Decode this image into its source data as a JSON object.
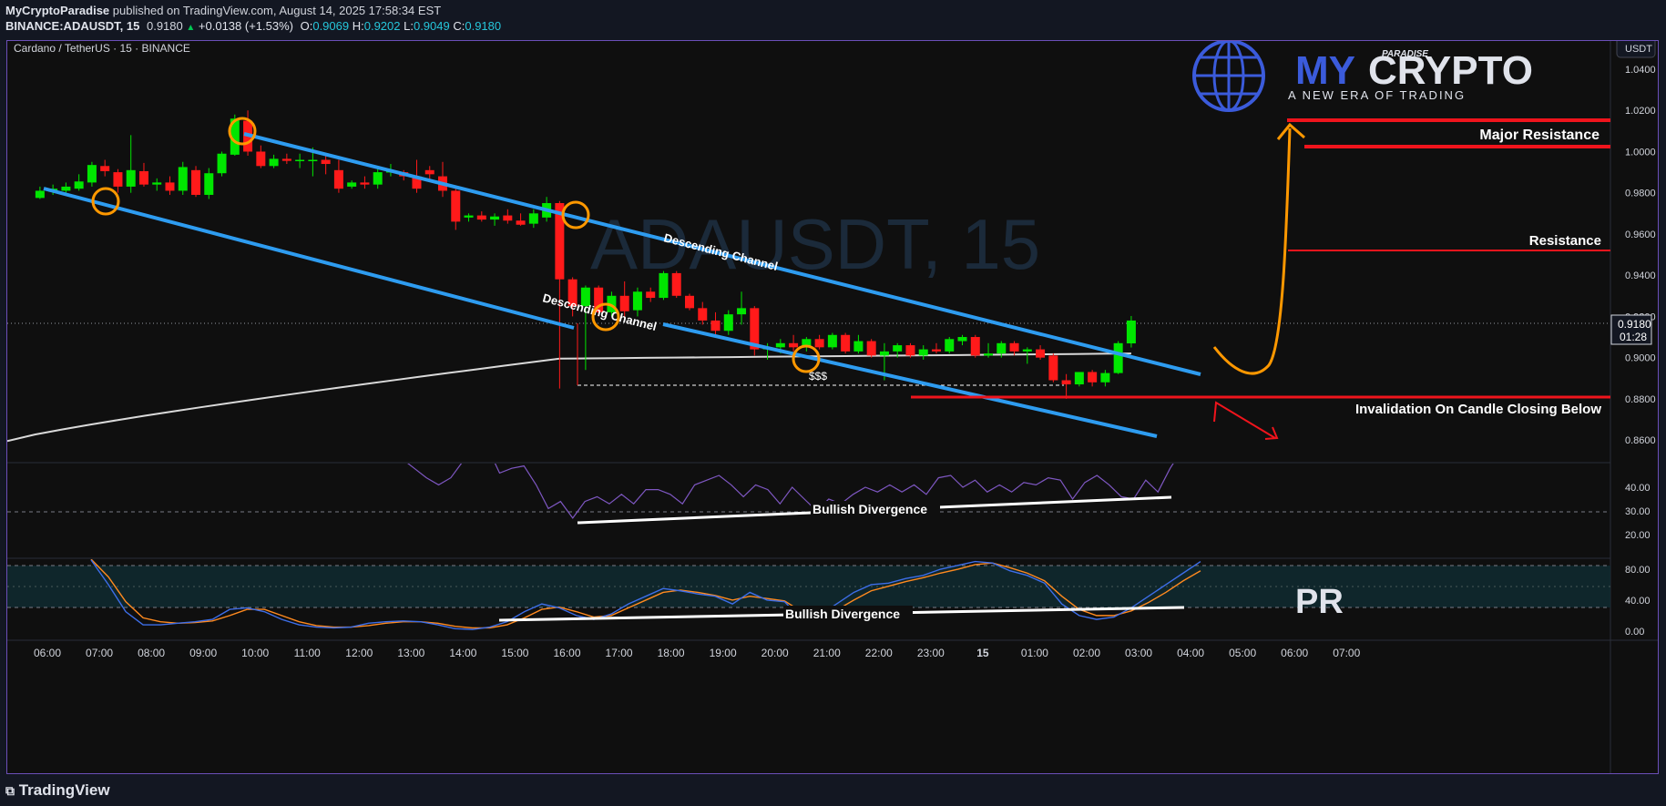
{
  "header": {
    "publisher": "MyCryptoParadise",
    "published_text": "published on TradingView.com, August 14, 2025 17:58:34 EST",
    "symbol_line": "BINANCE:ADAUSDT, 15",
    "last": "0.9180",
    "change": "+0.0138 (+1.53%)",
    "o_label": "O:",
    "o": "0.9069",
    "h_label": "H:",
    "h": "0.9202",
    "l_label": "L:",
    "l": "0.9049",
    "c_label": "C:",
    "c": "0.9180"
  },
  "chart_title": "Cardano / TetherUS · 15 · BINANCE",
  "watermark": "ADAUSDT, 15",
  "currency_button": "USDT",
  "brand": {
    "paradise": "PARADISE",
    "my": "MY",
    "crypto": "CRYPTO",
    "tagline": "A NEW ERA OF TRADING",
    "pr": "PR"
  },
  "footer": {
    "logo": "TradingView"
  },
  "price_tag": {
    "price": "0.9180",
    "countdown": "01:28"
  },
  "annotations": {
    "major_resistance": "Major Resistance",
    "resistance": "Resistance",
    "invalidation": "Invalidation On Candle Closing Below",
    "channel_upper": "Descending Channel",
    "channel_lower": "Descending Channel",
    "liquidity": "$$$",
    "rsi_divergence": "Bullish Divergence",
    "stoch_divergence": "Bullish Divergence"
  },
  "colors": {
    "up": "#00e600",
    "down": "#ff1a1a",
    "channel": "#2e9cf0",
    "resistance": "#f0141c",
    "projection": "#ff9800",
    "rsi": "#7e57c2",
    "stoch_k": "#3d6ee8",
    "stoch_d": "#ff8a1f",
    "accent_frame": "#6b4fb8"
  },
  "chart_data": [
    {
      "type": "candlestick",
      "title": "Cardano / TetherUS · 15 · BINANCE",
      "y_unit": "USDT",
      "ylim": [
        0.849,
        1.0537
      ],
      "x_ticks": [
        "06:00",
        "07:00",
        "08:00",
        "09:00",
        "10:00",
        "11:00",
        "12:00",
        "13:00",
        "14:00",
        "15:00",
        "16:00",
        "17:00",
        "18:00",
        "19:00",
        "20:00",
        "21:00",
        "22:00",
        "23:00",
        "15",
        "01:00",
        "02:00",
        "03:00",
        "04:00",
        "05:00",
        "06:00",
        "07:00"
      ],
      "y_ticks": [
        "1.0400",
        "1.0200",
        "1.0000",
        "0.9800",
        "0.9600",
        "0.9400",
        "0.9200",
        "0.9000",
        "0.8800",
        "0.8600"
      ],
      "candle_interval_minutes": 15,
      "first_candle_time": "05:45",
      "candles": [
        {
          "o": 0.9775,
          "h": 0.983,
          "l": 0.977,
          "c": 0.981
        },
        {
          "o": 0.9805,
          "h": 0.984,
          "l": 0.979,
          "c": 0.982
        },
        {
          "o": 0.981,
          "h": 0.985,
          "l": 0.98,
          "c": 0.983
        },
        {
          "o": 0.982,
          "h": 0.989,
          "l": 0.981,
          "c": 0.9855
        },
        {
          "o": 0.985,
          "h": 0.995,
          "l": 0.983,
          "c": 0.9935
        },
        {
          "o": 0.993,
          "h": 0.996,
          "l": 0.988,
          "c": 0.9905
        },
        {
          "o": 0.99,
          "h": 0.9915,
          "l": 0.98,
          "c": 0.983
        },
        {
          "o": 0.983,
          "h": 1.008,
          "l": 0.98,
          "c": 0.991
        },
        {
          "o": 0.9905,
          "h": 0.9945,
          "l": 0.983,
          "c": 0.984
        },
        {
          "o": 0.984,
          "h": 0.987,
          "l": 0.981,
          "c": 0.985
        },
        {
          "o": 0.985,
          "h": 0.988,
          "l": 0.979,
          "c": 0.981
        },
        {
          "o": 0.981,
          "h": 0.995,
          "l": 0.979,
          "c": 0.9925
        },
        {
          "o": 0.991,
          "h": 0.993,
          "l": 0.978,
          "c": 0.979
        },
        {
          "o": 0.979,
          "h": 0.992,
          "l": 0.977,
          "c": 0.9895
        },
        {
          "o": 0.9895,
          "h": 1.0,
          "l": 0.988,
          "c": 0.999
        },
        {
          "o": 0.9985,
          "h": 1.018,
          "l": 0.998,
          "c": 1.016
        },
        {
          "o": 1.015,
          "h": 1.02,
          "l": 0.998,
          "c": 1.0
        },
        {
          "o": 1.0,
          "h": 1.003,
          "l": 0.992,
          "c": 0.993
        },
        {
          "o": 0.993,
          "h": 0.9985,
          "l": 0.992,
          "c": 0.9965
        },
        {
          "o": 0.9965,
          "h": 0.999,
          "l": 0.994,
          "c": 0.9955
        },
        {
          "o": 0.9955,
          "h": 0.999,
          "l": 0.992,
          "c": 0.996
        },
        {
          "o": 0.996,
          "h": 1.002,
          "l": 0.988,
          "c": 0.996
        },
        {
          "o": 0.996,
          "h": 0.999,
          "l": 0.989,
          "c": 0.994
        },
        {
          "o": 0.991,
          "h": 0.996,
          "l": 0.98,
          "c": 0.982
        },
        {
          "o": 0.983,
          "h": 0.986,
          "l": 0.982,
          "c": 0.985
        },
        {
          "o": 0.985,
          "h": 0.988,
          "l": 0.982,
          "c": 0.984
        },
        {
          "o": 0.984,
          "h": 0.992,
          "l": 0.982,
          "c": 0.99
        },
        {
          "o": 0.99,
          "h": 0.994,
          "l": 0.988,
          "c": 0.9905
        },
        {
          "o": 0.99,
          "h": 0.991,
          "l": 0.986,
          "c": 0.988
        },
        {
          "o": 0.988,
          "h": 0.996,
          "l": 0.98,
          "c": 0.982
        },
        {
          "o": 0.991,
          "h": 0.993,
          "l": 0.986,
          "c": 0.989
        },
        {
          "o": 0.988,
          "h": 0.995,
          "l": 0.978,
          "c": 0.981
        },
        {
          "o": 0.981,
          "h": 0.982,
          "l": 0.962,
          "c": 0.966
        },
        {
          "o": 0.968,
          "h": 0.97,
          "l": 0.966,
          "c": 0.969
        },
        {
          "o": 0.969,
          "h": 0.971,
          "l": 0.966,
          "c": 0.967
        },
        {
          "o": 0.967,
          "h": 0.97,
          "l": 0.964,
          "c": 0.9685
        },
        {
          "o": 0.969,
          "h": 0.972,
          "l": 0.965,
          "c": 0.9665
        },
        {
          "o": 0.9665,
          "h": 0.97,
          "l": 0.964,
          "c": 0.9645
        },
        {
          "o": 0.965,
          "h": 0.972,
          "l": 0.963,
          "c": 0.97
        },
        {
          "o": 0.968,
          "h": 0.978,
          "l": 0.966,
          "c": 0.975
        },
        {
          "o": 0.975,
          "h": 0.976,
          "l": 0.885,
          "c": 0.938
        },
        {
          "o": 0.938,
          "h": 0.939,
          "l": 0.92,
          "c": 0.925
        },
        {
          "o": 0.925,
          "h": 0.935,
          "l": 0.894,
          "c": 0.934
        },
        {
          "o": 0.934,
          "h": 0.935,
          "l": 0.92,
          "c": 0.922
        },
        {
          "o": 0.922,
          "h": 0.932,
          "l": 0.92,
          "c": 0.93
        },
        {
          "o": 0.93,
          "h": 0.937,
          "l": 0.918,
          "c": 0.9225
        },
        {
          "o": 0.923,
          "h": 0.934,
          "l": 0.92,
          "c": 0.932
        },
        {
          "o": 0.932,
          "h": 0.934,
          "l": 0.927,
          "c": 0.929
        },
        {
          "o": 0.929,
          "h": 0.942,
          "l": 0.928,
          "c": 0.941
        },
        {
          "o": 0.941,
          "h": 0.942,
          "l": 0.929,
          "c": 0.93
        },
        {
          "o": 0.93,
          "h": 0.931,
          "l": 0.923,
          "c": 0.924
        },
        {
          "o": 0.924,
          "h": 0.927,
          "l": 0.916,
          "c": 0.918
        },
        {
          "o": 0.918,
          "h": 0.922,
          "l": 0.91,
          "c": 0.913
        },
        {
          "o": 0.913,
          "h": 0.923,
          "l": 0.911,
          "c": 0.921
        },
        {
          "o": 0.921,
          "h": 0.932,
          "l": 0.916,
          "c": 0.924
        },
        {
          "o": 0.924,
          "h": 0.925,
          "l": 0.901,
          "c": 0.904
        },
        {
          "o": 0.904,
          "h": 0.907,
          "l": 0.899,
          "c": 0.905
        },
        {
          "o": 0.905,
          "h": 0.909,
          "l": 0.902,
          "c": 0.907
        },
        {
          "o": 0.907,
          "h": 0.911,
          "l": 0.903,
          "c": 0.905
        },
        {
          "o": 0.905,
          "h": 0.91,
          "l": 0.903,
          "c": 0.909
        },
        {
          "o": 0.909,
          "h": 0.911,
          "l": 0.904,
          "c": 0.905
        },
        {
          "o": 0.905,
          "h": 0.912,
          "l": 0.904,
          "c": 0.911
        },
        {
          "o": 0.911,
          "h": 0.912,
          "l": 0.902,
          "c": 0.903
        },
        {
          "o": 0.903,
          "h": 0.911,
          "l": 0.902,
          "c": 0.908
        },
        {
          "o": 0.908,
          "h": 0.909,
          "l": 0.9,
          "c": 0.901
        },
        {
          "o": 0.901,
          "h": 0.907,
          "l": 0.889,
          "c": 0.903
        },
        {
          "o": 0.903,
          "h": 0.907,
          "l": 0.9,
          "c": 0.906
        },
        {
          "o": 0.906,
          "h": 0.907,
          "l": 0.9,
          "c": 0.901
        },
        {
          "o": 0.901,
          "h": 0.906,
          "l": 0.899,
          "c": 0.904
        },
        {
          "o": 0.904,
          "h": 0.907,
          "l": 0.902,
          "c": 0.903
        },
        {
          "o": 0.903,
          "h": 0.91,
          "l": 0.902,
          "c": 0.909
        },
        {
          "o": 0.908,
          "h": 0.911,
          "l": 0.906,
          "c": 0.91
        },
        {
          "o": 0.91,
          "h": 0.911,
          "l": 0.9,
          "c": 0.901
        },
        {
          "o": 0.901,
          "h": 0.907,
          "l": 0.9,
          "c": 0.902
        },
        {
          "o": 0.902,
          "h": 0.908,
          "l": 0.9,
          "c": 0.907
        },
        {
          "o": 0.907,
          "h": 0.908,
          "l": 0.901,
          "c": 0.903
        },
        {
          "o": 0.903,
          "h": 0.905,
          "l": 0.897,
          "c": 0.904
        },
        {
          "o": 0.904,
          "h": 0.906,
          "l": 0.899,
          "c": 0.9
        },
        {
          "o": 0.901,
          "h": 0.902,
          "l": 0.888,
          "c": 0.889
        },
        {
          "o": 0.889,
          "h": 0.892,
          "l": 0.88,
          "c": 0.887
        },
        {
          "o": 0.887,
          "h": 0.893,
          "l": 0.886,
          "c": 0.893
        },
        {
          "o": 0.893,
          "h": 0.894,
          "l": 0.886,
          "c": 0.888
        },
        {
          "o": 0.888,
          "h": 0.894,
          "l": 0.886,
          "c": 0.8925
        },
        {
          "o": 0.8925,
          "h": 0.908,
          "l": 0.892,
          "c": 0.907
        },
        {
          "o": 0.9069,
          "h": 0.9202,
          "l": 0.9049,
          "c": 0.918
        }
      ],
      "levels": [
        {
          "name": "Major Resistance",
          "values": [
            1.0275,
            1.013
          ]
        },
        {
          "name": "Resistance",
          "value": 0.957
        },
        {
          "name": "Invalidation On Candle Closing Below",
          "value": 0.8783
        },
        {
          "name": "$$$",
          "value": 0.8845
        }
      ],
      "moving_average": {
        "color": "#d9d9d9",
        "points": [
          [
            0,
            0.8595
          ],
          [
            40,
            0.8995
          ],
          [
            84,
            0.902
          ]
        ]
      }
    },
    {
      "type": "line",
      "title": "RSI",
      "ylim": [
        10,
        50
      ],
      "y_ticks": [
        "40.00",
        "30.00",
        "20.00"
      ],
      "guide": 30,
      "values": [
        56,
        52,
        48,
        44,
        41,
        44,
        51,
        62,
        57,
        46,
        48,
        49,
        41,
        31,
        34,
        27,
        34,
        36,
        33,
        37,
        33,
        39,
        39,
        37,
        33,
        41,
        43,
        45,
        41,
        36,
        41,
        39,
        33,
        40,
        35,
        30,
        35,
        33,
        37,
        40,
        38,
        41,
        38,
        41,
        37,
        44,
        45,
        40,
        43,
        38,
        41,
        38,
        42,
        41,
        44,
        43,
        35,
        42,
        45,
        41,
        36,
        35,
        43,
        38,
        48,
        56
      ]
    },
    {
      "type": "line",
      "title": "Stoch RSI",
      "ylim": [
        -12,
        93
      ],
      "y_ticks": [
        "80.00",
        "40.00",
        "0.00"
      ],
      "bands": [
        80,
        20
      ],
      "k": [
        92,
        60,
        25,
        8,
        8,
        10,
        12,
        15,
        28,
        30,
        25,
        15,
        8,
        5,
        4,
        5,
        10,
        12,
        13,
        12,
        8,
        3,
        2,
        5,
        12,
        25,
        35,
        30,
        20,
        15,
        22,
        35,
        45,
        55,
        52,
        48,
        45,
        35,
        50,
        40,
        38,
        15,
        20,
        35,
        50,
        60,
        62,
        68,
        72,
        80,
        85,
        90,
        88,
        78,
        72,
        62,
        35,
        20,
        15,
        18,
        30,
        45,
        60,
        75,
        90
      ],
      "d": [
        93,
        70,
        38,
        17,
        12,
        10,
        11,
        13,
        20,
        28,
        28,
        20,
        12,
        7,
        5,
        5,
        7,
        10,
        12,
        12,
        10,
        6,
        4,
        4,
        8,
        17,
        28,
        31,
        25,
        18,
        20,
        30,
        40,
        50,
        53,
        50,
        46,
        40,
        45,
        42,
        39,
        25,
        20,
        27,
        40,
        52,
        58,
        64,
        69,
        75,
        80,
        86,
        88,
        82,
        75,
        65,
        45,
        28,
        20,
        20,
        26,
        37,
        50,
        65,
        78
      ]
    }
  ]
}
